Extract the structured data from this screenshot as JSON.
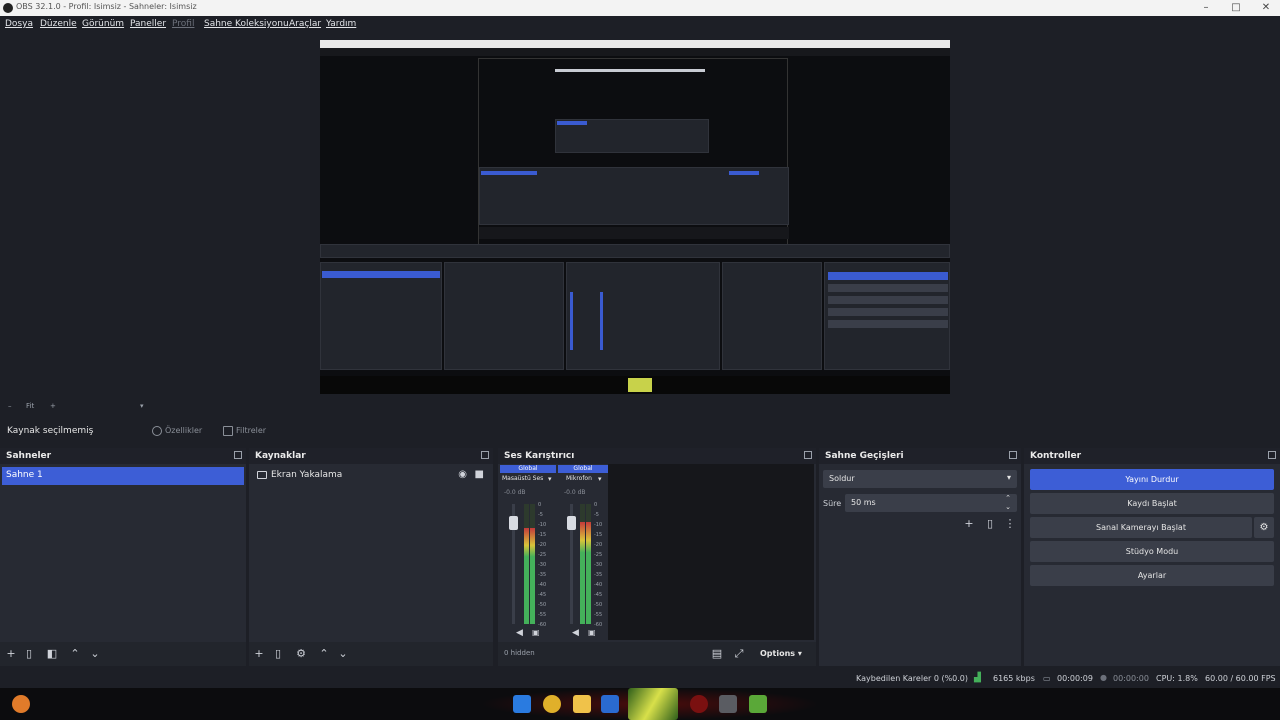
{
  "window": {
    "title": "OBS 32.1.0 - Profil: Isimsiz - Sahneler: Isimsiz"
  },
  "menu": [
    "Dosya",
    "Düzenle",
    "Görünüm",
    "Paneller",
    "Profil",
    "Sahne Koleksiyonu",
    "Araçlar",
    "Yardım"
  ],
  "source_bar": {
    "no_source": "Kaynak seçilmemiş",
    "properties": "Özellikler",
    "filters": "Filtreler"
  },
  "scenes": {
    "title": "Sahneler",
    "items": [
      "Sahne 1"
    ]
  },
  "sources": {
    "title": "Kaynaklar",
    "items": [
      "Ekran Yakalama"
    ]
  },
  "mixer": {
    "title": "Ses Karıştırıcı",
    "channels": [
      {
        "header": "Global",
        "name": "Masaüstü Ses",
        "db": "-0.0 dB",
        "level": 0.8
      },
      {
        "header": "Global",
        "name": "Mikrofon",
        "db": "-0.0 dB",
        "level": 0.85
      }
    ],
    "scale": [
      "0",
      "-5",
      "-10",
      "-15",
      "-20",
      "-25",
      "-30",
      "-35",
      "-40",
      "-45",
      "-50",
      "-55",
      "-60"
    ],
    "footer_text": "0 hidden",
    "options_label": "Options"
  },
  "transitions": {
    "title": "Sahne Geçişleri",
    "type": "Soldur",
    "duration_label": "Süre",
    "duration_value": "50 ms"
  },
  "controls": {
    "title": "Kontroller",
    "buttons": [
      "Yayını Durdur",
      "Kaydı Başlat",
      "Sanal Kamerayı Başlat",
      "Stüdyo Modu",
      "Ayarlar"
    ]
  },
  "status": {
    "dropped": "Kaybedilen Kareler 0 (%0.0)",
    "bitrate": "6165 kbps",
    "stream_time": "00:00:09",
    "rec_time": "00:00:00",
    "cpu": "CPU: 1.8%",
    "fps": "60.00 / 60.00 FPS"
  },
  "colors": {
    "accent": "#3d5ed6",
    "dock": "#272a33",
    "bg": "#1d1f26"
  }
}
